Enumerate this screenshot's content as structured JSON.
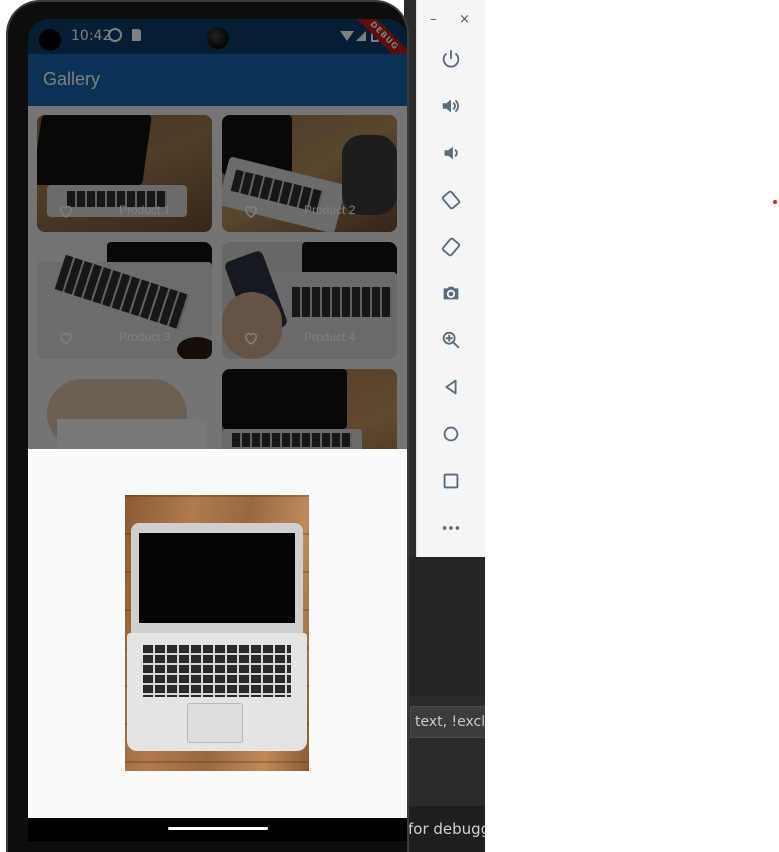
{
  "status_bar": {
    "time": "10:42",
    "debug_banner": "DEBUG"
  },
  "app_bar": {
    "title": "Gallery"
  },
  "gallery": {
    "items": [
      {
        "label": "Product 1"
      },
      {
        "label": "Product 2"
      },
      {
        "label": "Product 3"
      },
      {
        "label": "Product 4"
      }
    ]
  },
  "emulator_toolbar": {
    "minimize": "–",
    "close": "×",
    "buttons": [
      "power-icon",
      "volume-up-icon",
      "volume-down-icon",
      "rotate-left-icon",
      "rotate-right-icon",
      "camera-icon",
      "zoom-icon",
      "back-icon",
      "home-icon",
      "overview-icon",
      "more-icon"
    ]
  },
  "ide": {
    "search_text": "text, !exclu",
    "debug_text": "for debugg"
  }
}
